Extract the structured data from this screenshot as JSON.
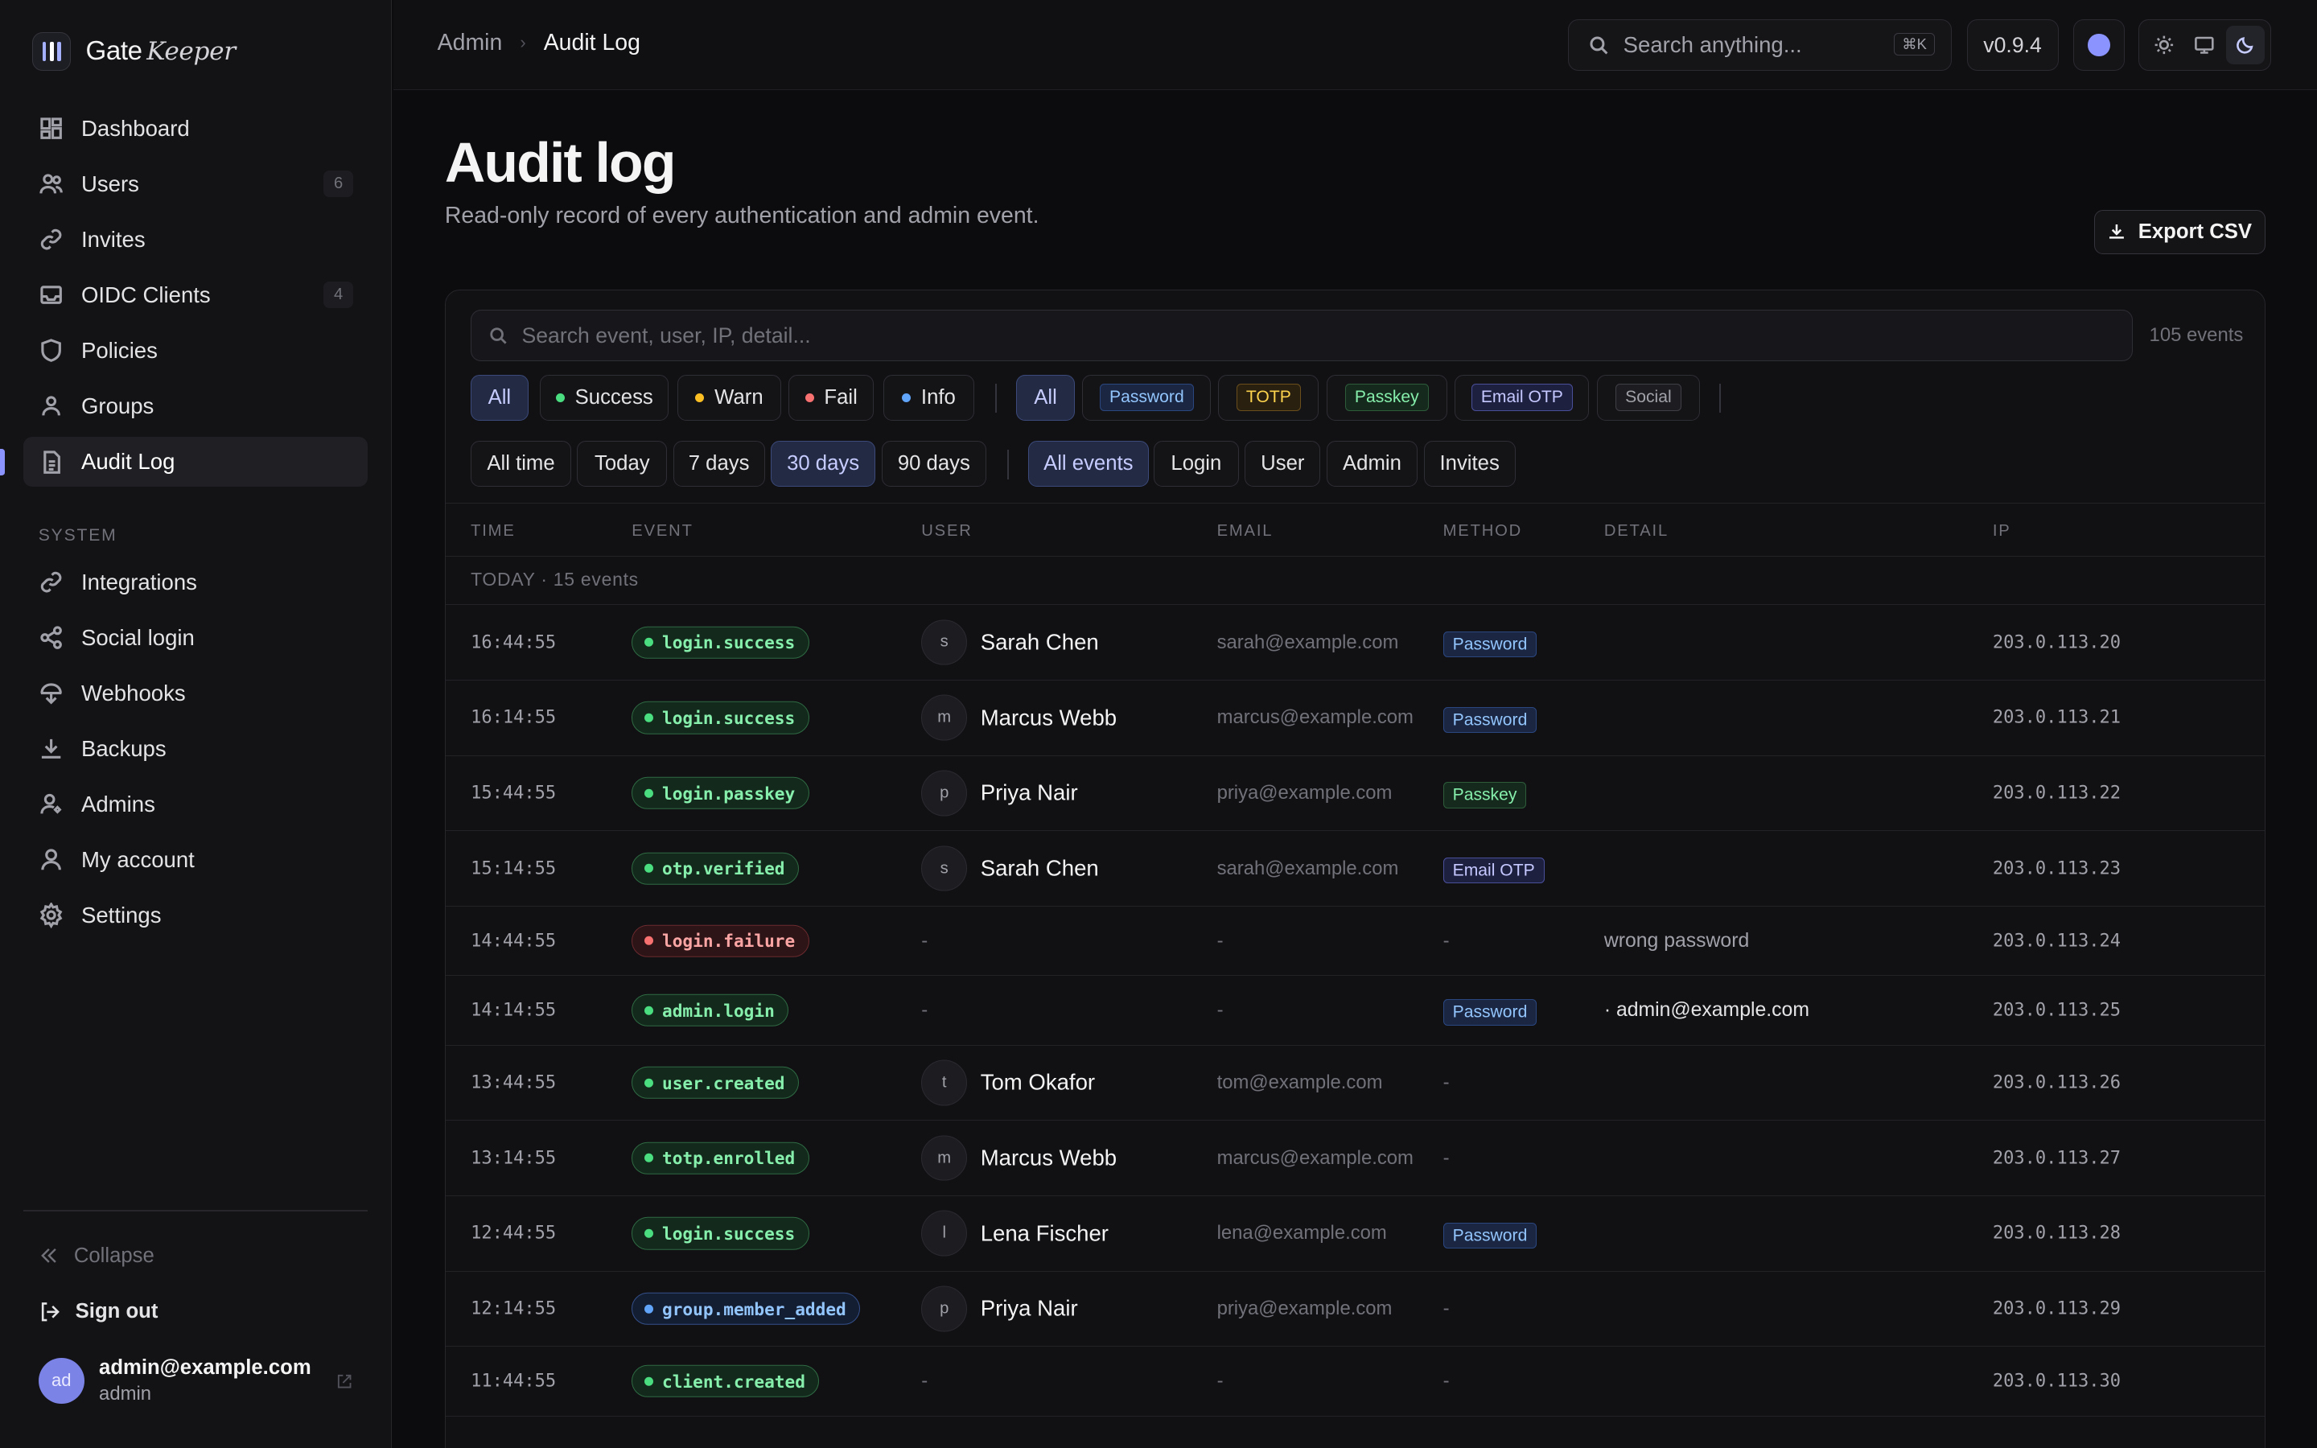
{
  "brand": {
    "name": "Gate",
    "name_em": "Keeper"
  },
  "sidebar": {
    "items": [
      {
        "label": "Dashboard",
        "icon": "dashboard-icon"
      },
      {
        "label": "Users",
        "icon": "users-icon",
        "count": "6"
      },
      {
        "label": "Invites",
        "icon": "link-icon"
      },
      {
        "label": "OIDC Clients",
        "icon": "inbox-icon",
        "count": "4"
      },
      {
        "label": "Policies",
        "icon": "shield-icon"
      },
      {
        "label": "Groups",
        "icon": "group-icon"
      },
      {
        "label": "Audit Log",
        "icon": "document-icon",
        "active": true
      }
    ],
    "system_label": "SYSTEM",
    "system_items": [
      {
        "label": "Integrations",
        "icon": "link-icon"
      },
      {
        "label": "Social login",
        "icon": "share-icon"
      },
      {
        "label": "Webhooks",
        "icon": "webhook-icon"
      },
      {
        "label": "Backups",
        "icon": "download-icon"
      },
      {
        "label": "Admins",
        "icon": "admin-icon"
      },
      {
        "label": "My account",
        "icon": "user-icon"
      },
      {
        "label": "Settings",
        "icon": "gear-icon"
      }
    ],
    "collapse_label": "Collapse",
    "signout_label": "Sign out",
    "user": {
      "initials": "ad",
      "email": "admin@example.com",
      "role": "admin"
    }
  },
  "topbar": {
    "breadcrumb": [
      "Admin",
      "Audit Log"
    ],
    "search_placeholder": "Search anything...",
    "shortcut": "⌘K",
    "version": "v0.9.4"
  },
  "page": {
    "title": "Audit log",
    "subtitle": "Read-only record of every authentication and admin event.",
    "export_label": "Export CSV"
  },
  "filters": {
    "search_placeholder": "Search event, user, IP, detail...",
    "count": "105 events",
    "status": [
      {
        "label": "All",
        "selected": true
      },
      {
        "label": "Success",
        "dot": "#4ade80"
      },
      {
        "label": "Warn",
        "dot": "#fbbf24"
      },
      {
        "label": "Fail",
        "dot": "#f87171"
      },
      {
        "label": "Info",
        "dot": "#60a5fa"
      }
    ],
    "method_all": "All",
    "methods": [
      "Password",
      "TOTP",
      "Passkey",
      "Email OTP",
      "Social"
    ],
    "ranges": [
      {
        "label": "All time"
      },
      {
        "label": "Today"
      },
      {
        "label": "7 days"
      },
      {
        "label": "30 days",
        "selected": true
      },
      {
        "label": "90 days"
      }
    ],
    "kinds": [
      {
        "label": "All events",
        "selected": true
      },
      {
        "label": "Login"
      },
      {
        "label": "User"
      },
      {
        "label": "Admin"
      },
      {
        "label": "Invites"
      }
    ]
  },
  "table": {
    "columns": [
      "TIME",
      "EVENT",
      "USER",
      "EMAIL",
      "METHOD",
      "DETAIL",
      "IP"
    ],
    "group": "TODAY · 15 events",
    "rows": [
      {
        "time": "16:44:55",
        "event": "login.success",
        "tone": "g",
        "initial": "s",
        "user": "Sarah Chen",
        "email": "sarah@example.com",
        "method": "Password",
        "detail": "",
        "ip": "203.0.113.20"
      },
      {
        "time": "16:14:55",
        "event": "login.success",
        "tone": "g",
        "initial": "m",
        "user": "Marcus Webb",
        "email": "marcus@example.com",
        "method": "Password",
        "detail": "",
        "ip": "203.0.113.21"
      },
      {
        "time": "15:44:55",
        "event": "login.passkey",
        "tone": "g",
        "initial": "p",
        "user": "Priya Nair",
        "email": "priya@example.com",
        "method": "Passkey",
        "detail": "",
        "ip": "203.0.113.22"
      },
      {
        "time": "15:14:55",
        "event": "otp.verified",
        "tone": "g",
        "initial": "s",
        "user": "Sarah Chen",
        "email": "sarah@example.com",
        "method": "Email OTP",
        "detail": "",
        "ip": "203.0.113.23"
      },
      {
        "time": "14:44:55",
        "event": "login.failure",
        "tone": "r",
        "initial": "",
        "user": "-",
        "email": "-",
        "method": "-",
        "detail": "wrong password",
        "ip": "203.0.113.24"
      },
      {
        "time": "14:14:55",
        "event": "admin.login",
        "tone": "g",
        "initial": "",
        "user": "-",
        "email": "-",
        "method": "Password",
        "detail": "· admin@example.com",
        "ip": "203.0.113.25"
      },
      {
        "time": "13:44:55",
        "event": "user.created",
        "tone": "g",
        "initial": "t",
        "user": "Tom Okafor",
        "email": "tom@example.com",
        "method": "-",
        "detail": "",
        "ip": "203.0.113.26"
      },
      {
        "time": "13:14:55",
        "event": "totp.enrolled",
        "tone": "g",
        "initial": "m",
        "user": "Marcus Webb",
        "email": "marcus@example.com",
        "method": "-",
        "detail": "",
        "ip": "203.0.113.27"
      },
      {
        "time": "12:44:55",
        "event": "login.success",
        "tone": "g",
        "initial": "l",
        "user": "Lena Fischer",
        "email": "lena@example.com",
        "method": "Password",
        "detail": "",
        "ip": "203.0.113.28"
      },
      {
        "time": "12:14:55",
        "event": "group.member_added",
        "tone": "b",
        "initial": "p",
        "user": "Priya Nair",
        "email": "priya@example.com",
        "method": "-",
        "detail": "",
        "ip": "203.0.113.29"
      },
      {
        "time": "11:44:55",
        "event": "client.created",
        "tone": "g",
        "initial": "",
        "user": "-",
        "email": "-",
        "method": "-",
        "detail": "",
        "ip": "203.0.113.30"
      }
    ]
  }
}
